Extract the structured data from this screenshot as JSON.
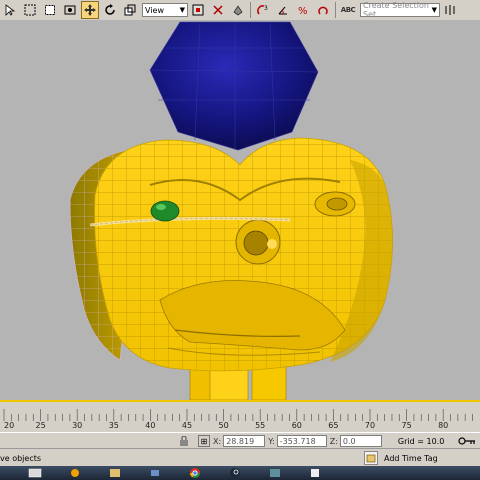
{
  "toolbar": {
    "view_select": "View",
    "selection_set_placeholder": "Create Selection Set",
    "abc_label": "ABC"
  },
  "timeline": {
    "ticks": [
      "20",
      "25",
      "30",
      "35",
      "40",
      "45",
      "50",
      "55",
      "60",
      "65",
      "70",
      "75",
      "80"
    ]
  },
  "status": {
    "x_label": "X:",
    "x_value": "28.819",
    "y_label": "Y:",
    "y_value": "-353.718",
    "z_label": "Z:",
    "z_value": "0.0",
    "grid": "Grid = 10.0"
  },
  "prompt": {
    "text": "ve objects",
    "add_time_tag": "Add Time Tag"
  },
  "colors": {
    "viewport_bg": "#b4b4b4",
    "mesh_yellow": "#f1c500",
    "sphere_blue": "#14147a",
    "eye_green": "#1f8a2a"
  }
}
